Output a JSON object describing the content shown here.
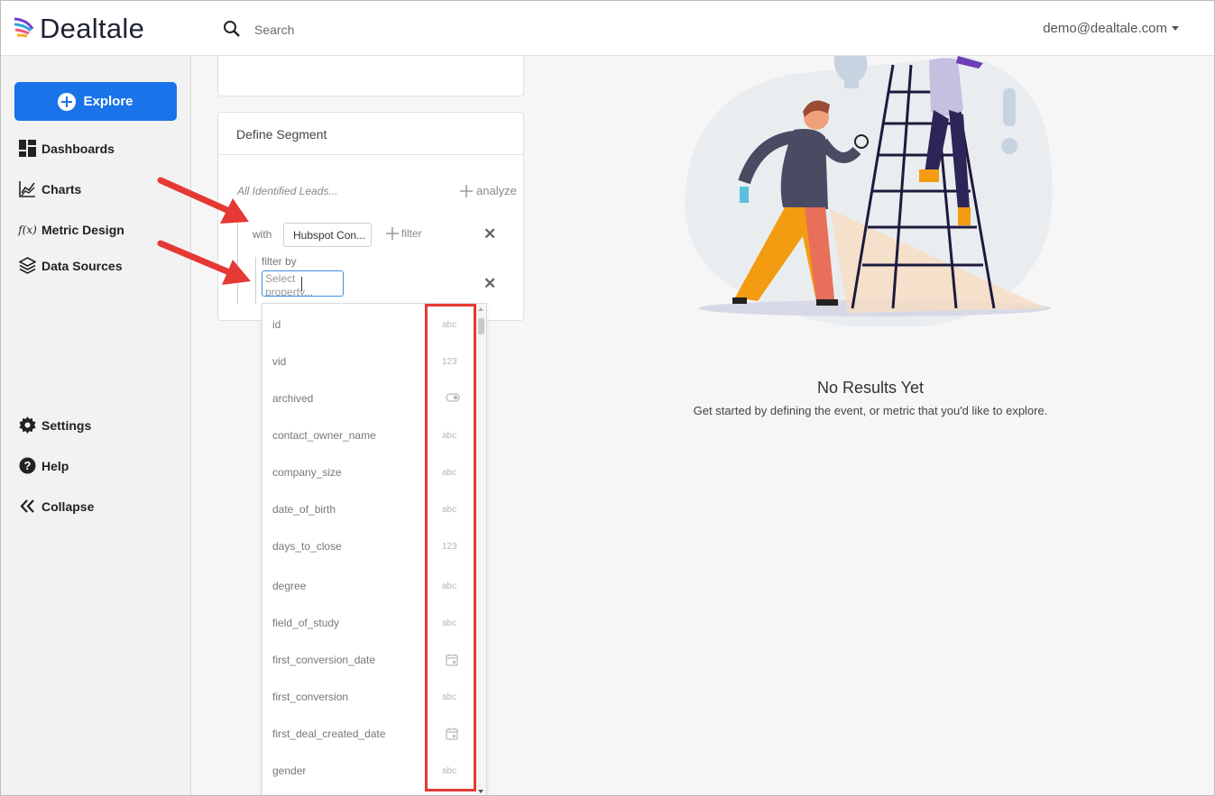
{
  "header": {
    "logo_text": "Dealtale",
    "search_placeholder": "Search",
    "user_email": "demo@dealtale.com"
  },
  "sidebar": {
    "explore_label": "Explore",
    "items": [
      {
        "label": "Dashboards",
        "icon": "dashboard-icon"
      },
      {
        "label": "Charts",
        "icon": "chart-icon"
      },
      {
        "label": "Metric Design",
        "icon": "function-icon"
      },
      {
        "label": "Data Sources",
        "icon": "layers-icon"
      }
    ],
    "bottom_items": [
      {
        "label": "Settings",
        "icon": "gear-icon"
      },
      {
        "label": "Help",
        "icon": "help-icon"
      },
      {
        "label": "Collapse",
        "icon": "double-chevron-left-icon"
      }
    ]
  },
  "segment": {
    "title": "Define Segment",
    "leads_text": "All Identified Leads...",
    "analyze_label": "analyze",
    "with_label": "with",
    "source_value": "Hubspot Con...",
    "filter_label": "filter",
    "filter_by_label": "filter by",
    "property_placeholder": "Select property..."
  },
  "dropdown": {
    "properties": [
      {
        "name": "id",
        "type": "abc"
      },
      {
        "name": "vid",
        "type": "123"
      },
      {
        "name": "archived",
        "type": "toggle-icon"
      },
      {
        "name": "contact_owner_name",
        "type": "abc"
      },
      {
        "name": "company_size",
        "type": "abc"
      },
      {
        "name": "date_of_birth",
        "type": "abc"
      },
      {
        "name": "days_to_close",
        "type": "123"
      },
      {
        "name": "degree",
        "type": "abc"
      },
      {
        "name": "field_of_study",
        "type": "abc"
      },
      {
        "name": "first_conversion_date",
        "type": "calendar-icon"
      },
      {
        "name": "first_conversion",
        "type": "abc"
      },
      {
        "name": "first_deal_created_date",
        "type": "calendar-icon"
      },
      {
        "name": "gender",
        "type": "abc"
      }
    ]
  },
  "main": {
    "empty_title": "No Results Yet",
    "empty_subtitle": "Get started by defining the event, or metric that you'd like to explore."
  },
  "colors": {
    "primary": "#1a73e8",
    "highlight": "#e53935"
  }
}
